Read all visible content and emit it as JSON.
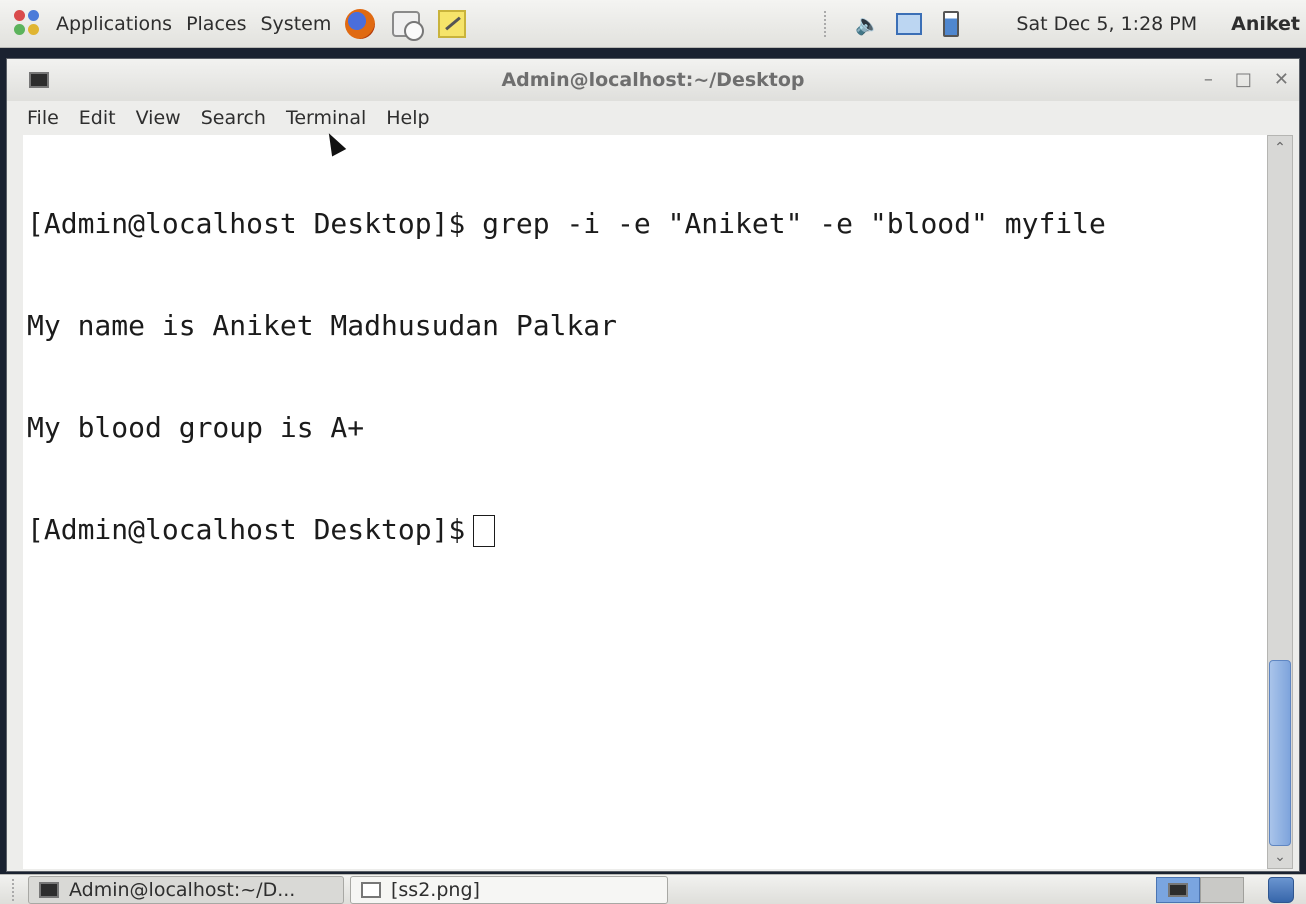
{
  "top_panel": {
    "menus": [
      "Applications",
      "Places",
      "System"
    ],
    "clock": "Sat Dec  5,  1:28 PM",
    "user": "Aniket"
  },
  "window": {
    "title": "Admin@localhost:~/Desktop",
    "menu": [
      "File",
      "Edit",
      "View",
      "Search",
      "Terminal",
      "Help"
    ]
  },
  "terminal": {
    "lines": [
      "[Admin@localhost Desktop]$ grep -i -e \"Aniket\" -e \"blood\" myfile",
      "My name is Aniket Madhusudan Palkar",
      "My blood group is A+",
      "[Admin@localhost Desktop]$"
    ]
  },
  "taskbar": {
    "tasks": [
      "Admin@localhost:~/D...",
      "[ss2.png]"
    ]
  },
  "colors": {
    "accent": "#7ea4dc",
    "terminal_bg": "#ffffff",
    "terminal_fg": "#1b1b1b"
  }
}
